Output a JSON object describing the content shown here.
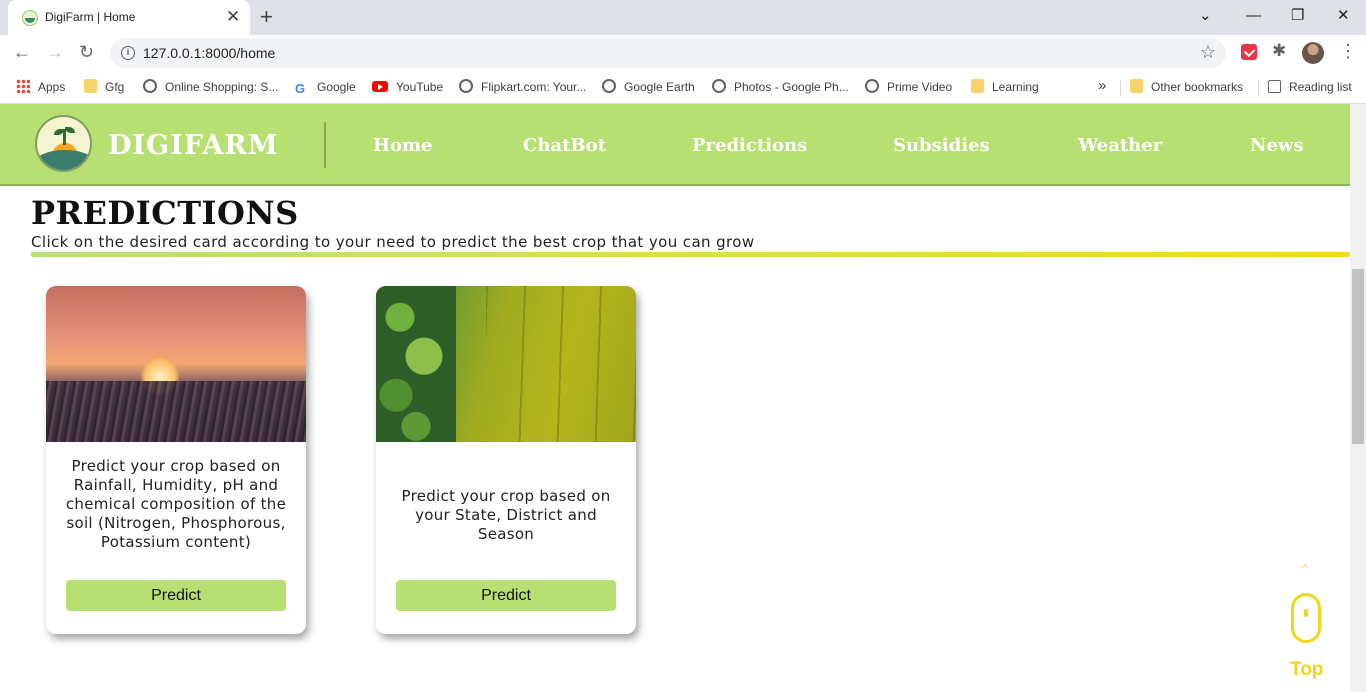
{
  "browser": {
    "tab_title": "DigiFarm | Home",
    "url": "127.0.0.1:8000/home",
    "bookmarks": [
      {
        "label": "Apps",
        "icon": "apps-grid-icon"
      },
      {
        "label": "Gfg",
        "icon": "folder-icon"
      },
      {
        "label": "Online Shopping: S...",
        "icon": "globe-icon"
      },
      {
        "label": "Google",
        "icon": "google-icon"
      },
      {
        "label": "YouTube",
        "icon": "youtube-icon"
      },
      {
        "label": "Flipkart.com: Your...",
        "icon": "globe-icon"
      },
      {
        "label": "Google Earth",
        "icon": "globe-icon"
      },
      {
        "label": "Photos - Google Ph...",
        "icon": "globe-icon"
      },
      {
        "label": "Prime Video",
        "icon": "globe-icon"
      },
      {
        "label": "Learning",
        "icon": "folder-icon"
      }
    ],
    "more_bookmarks": "»",
    "other_bookmarks": "Other bookmarks",
    "reading_list": "Reading list"
  },
  "site": {
    "brand": "DIGIFARM",
    "nav": [
      "Home",
      "ChatBot",
      "Predictions",
      "Subsidies",
      "Weather",
      "News"
    ],
    "accent_color": "#b8df72"
  },
  "main": {
    "heading": "PREDICTIONS",
    "subheading": "Click on the desired card according to your need to predict the best crop that you can grow",
    "cards": [
      {
        "image": "wheat-field-sunset-image",
        "text": "Predict your crop based on Rainfall, Humidity, pH and chemical composition of the soil (Nitrogen, Phosphorous, Potassium content)",
        "button": "Predict"
      },
      {
        "image": "aerial-green-field-image",
        "text": "Predict your crop based on your State, District and Season",
        "button": "Predict"
      }
    ]
  },
  "scroll_top": {
    "label": "Top",
    "icon": "mouse-scroll-icon",
    "color": "#f1d51b"
  }
}
